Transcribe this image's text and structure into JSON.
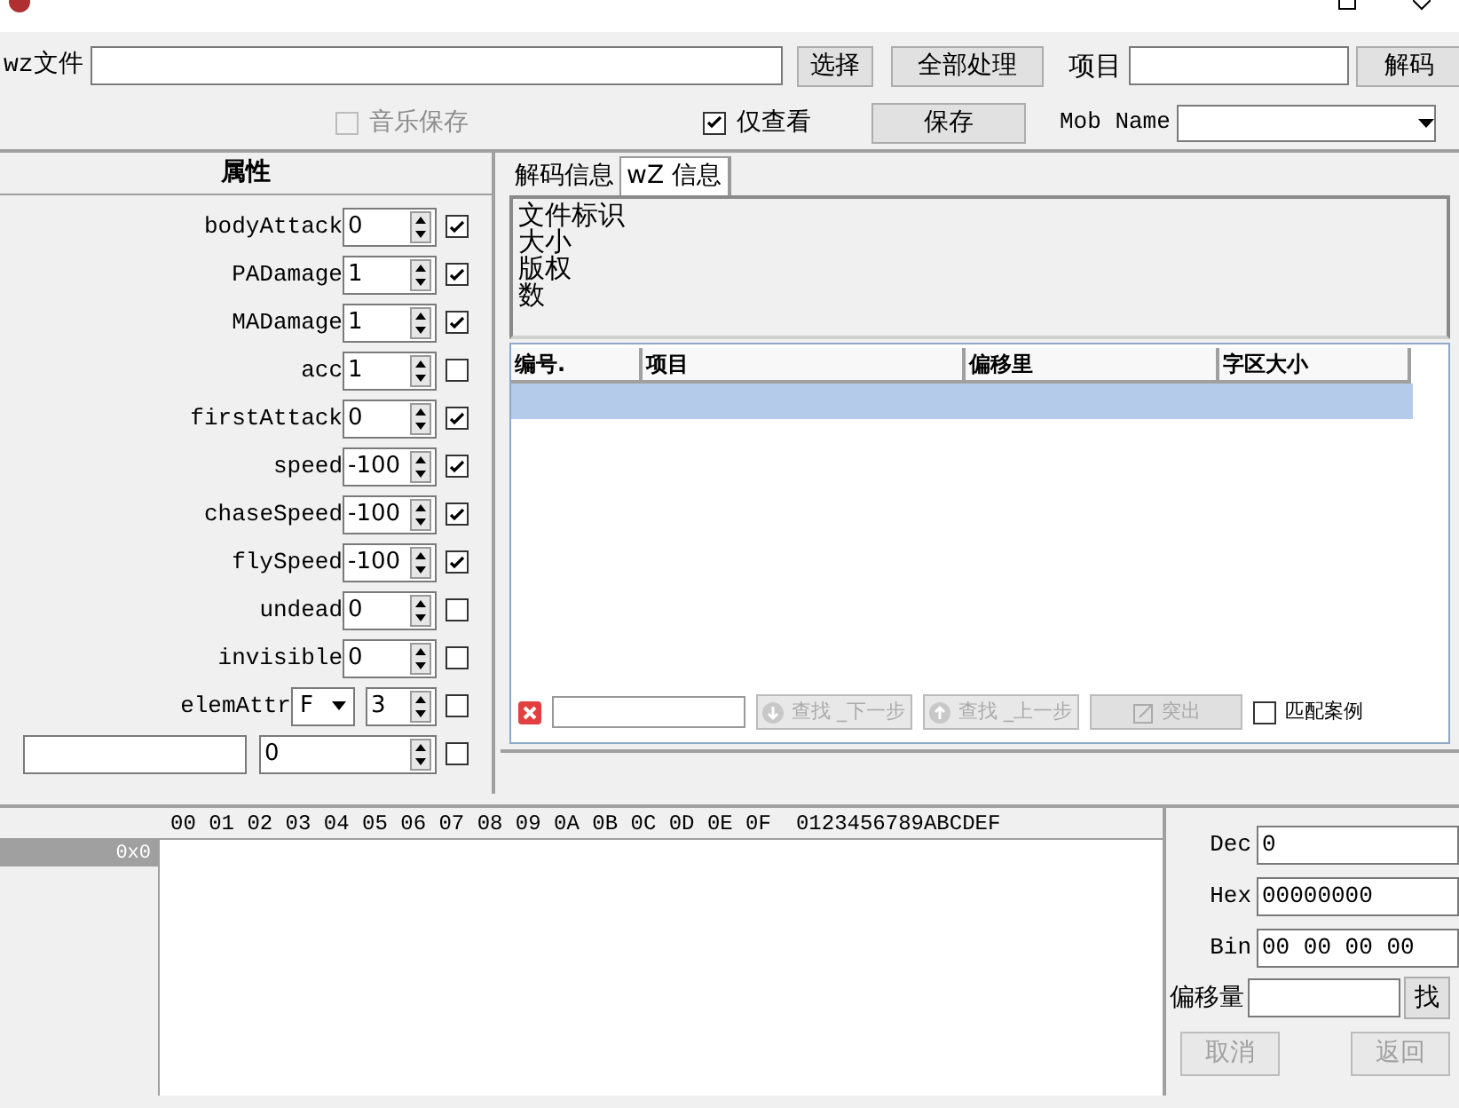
{
  "toolbar": {
    "file_label": "wz文件",
    "select_button": "选择",
    "process_all_button": "全部处理",
    "item_label": "项目",
    "decode_button": "解码",
    "music_save": {
      "label": "音乐保存",
      "checked": false,
      "disabled": true
    },
    "view_only": {
      "label": "仅查看",
      "checked": true,
      "disabled": false
    },
    "save_button": "保存",
    "mob_name_label": "Mob Name"
  },
  "properties": {
    "title": "属性",
    "rows": [
      {
        "kind": "spin",
        "label": "bodyAttack",
        "value": "0",
        "checked": true
      },
      {
        "kind": "spin",
        "label": "PADamage",
        "value": "1",
        "checked": true
      },
      {
        "kind": "spin",
        "label": "MADamage",
        "value": "1",
        "checked": true
      },
      {
        "kind": "spin",
        "label": "acc",
        "value": "1",
        "checked": false
      },
      {
        "kind": "spin",
        "label": "firstAttack",
        "value": "0",
        "checked": true
      },
      {
        "kind": "spin",
        "label": "speed",
        "value": "-100",
        "checked": true
      },
      {
        "kind": "spin",
        "label": "chaseSpeed",
        "value": "-100",
        "checked": true
      },
      {
        "kind": "spin",
        "label": "flySpeed",
        "value": "-100",
        "checked": true
      },
      {
        "kind": "spin",
        "label": "undead",
        "value": "0",
        "checked": false
      },
      {
        "kind": "spin",
        "label": "invisible",
        "value": "0",
        "checked": false
      },
      {
        "kind": "select_spin",
        "label": "elemAttr",
        "option": "F",
        "value": "3",
        "checked": false
      },
      {
        "kind": "blank",
        "value": "0",
        "checked": false
      }
    ]
  },
  "tabs": [
    {
      "label": "解码信息",
      "selected": false
    },
    {
      "label": "wZ 信息",
      "selected": true
    }
  ],
  "info_lines": [
    "文件标识",
    "大小",
    "版权",
    "数"
  ],
  "table": {
    "columns": [
      "编号.",
      "项目",
      "偏移里",
      "字区大小"
    ]
  },
  "find_bar": {
    "next_button": "查找 _下一步",
    "prev_button": "查找 _上一步",
    "highlight_button": "突出",
    "match_case": {
      "label": "匹配案例",
      "checked": false
    }
  },
  "hex": {
    "header": "00 01 02 03 04 05 06 07 08 09 0A 0B 0C 0D 0E 0F",
    "ascii_header": "0123456789ABCDEF",
    "address": "0x0"
  },
  "converter": {
    "fields": [
      {
        "label": "Dec",
        "value": "0"
      },
      {
        "label": "Hex",
        "value": "00000000"
      },
      {
        "label": "Bin",
        "value": "00 00 00 00"
      }
    ],
    "offset_label": "偏移量",
    "find_button": "找",
    "cancel_button": "取消",
    "back_button": "返回"
  }
}
